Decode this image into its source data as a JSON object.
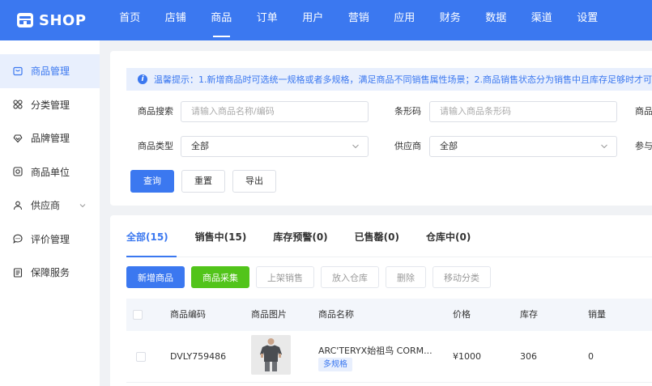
{
  "app": {
    "logo_text": "SHOP"
  },
  "nav": [
    "首页",
    "店铺",
    "商品",
    "订单",
    "用户",
    "营销",
    "应用",
    "财务",
    "数据",
    "渠道",
    "设置"
  ],
  "sidebar": {
    "items": [
      {
        "label": "商品管理",
        "icon": "product-icon"
      },
      {
        "label": "分类管理",
        "icon": "category-icon"
      },
      {
        "label": "品牌管理",
        "icon": "brand-icon"
      },
      {
        "label": "商品单位",
        "icon": "unit-icon"
      },
      {
        "label": "供应商",
        "icon": "supplier-icon"
      },
      {
        "label": "评价管理",
        "icon": "comment-icon"
      },
      {
        "label": "保障服务",
        "icon": "service-icon"
      }
    ]
  },
  "tip": {
    "text": "温馨提示：1.新增商品时可选统一规格或者多规格，满足商品不同销售属性场景；2.商品销售状态分为销售中且库存足够时才可下单购买。"
  },
  "filter": {
    "search_label": "商品搜索",
    "search_placeholder": "请输入商品名称/编码",
    "barcode_label": "条形码",
    "barcode_placeholder": "请输入商品条形码",
    "extra_label_1": "商品",
    "type_label": "商品类型",
    "type_value": "全部",
    "supplier_label": "供应商",
    "supplier_value": "全部",
    "extra_label_2": "参与",
    "query": "查询",
    "reset": "重置",
    "export": "导出"
  },
  "tabs": [
    "全部(15)",
    "销售中(15)",
    "库存预警(0)",
    "已售罄(0)",
    "仓库中(0)"
  ],
  "actions": [
    "新增商品",
    "商品采集",
    "上架销售",
    "放入仓库",
    "删除",
    "移动分类"
  ],
  "table": {
    "headers": [
      "商品编码",
      "商品图片",
      "商品名称",
      "价格",
      "库存",
      "销量"
    ],
    "rows": [
      {
        "code": "DVLY759486",
        "name": "ARC'TERYX始祖鸟 CORM...",
        "tag": "多规格",
        "price": "¥1000",
        "stock": "306",
        "sales": "0"
      }
    ]
  },
  "colors": {
    "primary": "#3b78f0",
    "green": "#52c41a"
  }
}
